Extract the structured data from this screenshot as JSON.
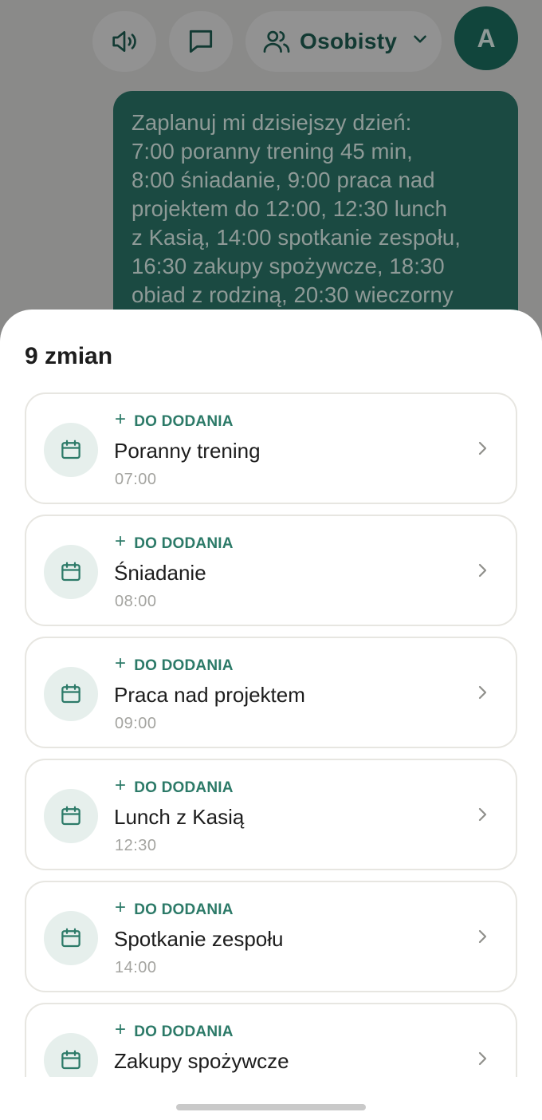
{
  "header": {
    "speaker_icon": "speaker-icon",
    "chat_icon": "chat-icon",
    "account_label": "Osobisty",
    "account_icon": "people-icon",
    "avatar_letter": "A"
  },
  "chat": {
    "message": "Zaplanuj mi dzisiejszy dzień:\n7:00 poranny trening 45 min,\n8:00 śniadanie, 9:00 praca nad\nprojektem do 12:00, 12:30 lunch\nz Kasią, 14:00 spotkanie zespołu,\n16:30 zakupy spożywcze, 18:30\nobiad z rodziną, 20:30 wieczorny"
  },
  "sheet": {
    "title": "9 zmian",
    "items": [
      {
        "status": "DO DODANIA",
        "title": "Poranny trening",
        "time": "07:00"
      },
      {
        "status": "DO DODANIA",
        "title": "Śniadanie",
        "time": "08:00"
      },
      {
        "status": "DO DODANIA",
        "title": "Praca nad projektem",
        "time": "09:00"
      },
      {
        "status": "DO DODANIA",
        "title": "Lunch z Kasią",
        "time": "12:30"
      },
      {
        "status": "DO DODANIA",
        "title": "Spotkanie zespołu",
        "time": "14:00"
      },
      {
        "status": "DO DODANIA",
        "title": "Zakupy spożywcze",
        "time": ""
      }
    ]
  },
  "colors": {
    "accent": "#2c7a68",
    "avatar_bg": "#11453c",
    "message_bg": "#1b4a42",
    "icon_bg": "#e6efec",
    "card_border": "#e7e6e1"
  }
}
